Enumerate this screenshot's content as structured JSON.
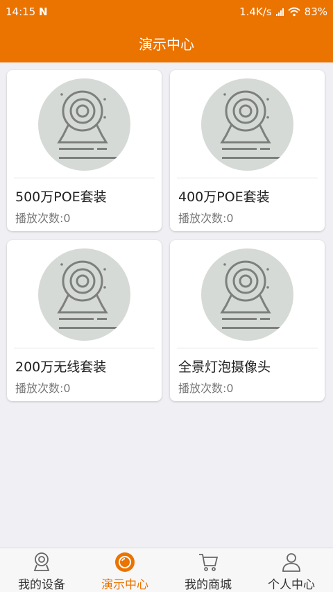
{
  "status_bar": {
    "time": "14:15",
    "notification": "N",
    "network_speed": "1.4K/s",
    "battery": "83%"
  },
  "header": {
    "title": "演示中心"
  },
  "cards": [
    {
      "name": "500万POE套装",
      "plays": "播放次数:0"
    },
    {
      "name": "400万POE套装",
      "plays": "播放次数:0"
    },
    {
      "name": "200万无线套装",
      "plays": "播放次数:0"
    },
    {
      "name": "全景灯泡摄像头",
      "plays": "播放次数:0"
    }
  ],
  "tabs": [
    {
      "label": "我的设备",
      "icon": "camera-icon"
    },
    {
      "label": "演示中心",
      "icon": "demo-icon",
      "active": true
    },
    {
      "label": "我的商城",
      "icon": "cart-icon"
    },
    {
      "label": "个人中心",
      "icon": "person-icon"
    }
  ],
  "colors": {
    "accent": "#eb7300",
    "background": "#efeff4",
    "thumb": "#d6dad6"
  }
}
